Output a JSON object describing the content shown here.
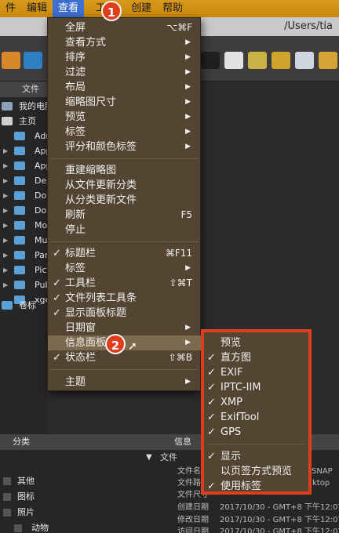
{
  "menubar": {
    "items": [
      {
        "label": "件"
      },
      {
        "label": "编辑"
      },
      {
        "label": "查看"
      },
      {
        "label": "工"
      },
      {
        "label": "创建"
      },
      {
        "label": "帮助"
      }
    ]
  },
  "window": {
    "path": "/Users/tia"
  },
  "folders": {
    "header": "文件夹",
    "items": [
      {
        "label": "我的电脑"
      },
      {
        "label": "主页"
      },
      {
        "label": "Adm"
      },
      {
        "label": "App"
      },
      {
        "label": "App"
      },
      {
        "label": "Des"
      },
      {
        "label": "Doc"
      },
      {
        "label": "Dow"
      },
      {
        "label": "Mov"
      },
      {
        "label": "Mus"
      },
      {
        "label": "Par"
      },
      {
        "label": "Pict"
      },
      {
        "label": "Pub"
      },
      {
        "label": "xge"
      },
      {
        "label": "卷标"
      }
    ]
  },
  "category": {
    "header": "分类",
    "items": [
      {
        "label": "其他"
      },
      {
        "label": "图标"
      },
      {
        "label": "照片"
      },
      {
        "label": "动物"
      }
    ]
  },
  "info": {
    "header": "信息",
    "section": "文件",
    "rows": [
      {
        "key": "文件名",
        "value": "_SNAP"
      },
      {
        "key": "文件路",
        "value": "ktop"
      },
      {
        "key": "文件尺寸",
        "value": ""
      },
      {
        "key": "创建日期",
        "value": "2017/10/30 - GMT+8 下午12:07:"
      },
      {
        "key": "修改日期",
        "value": "2017/10/30 - GMT+8 下午12:07:"
      },
      {
        "key": "访问日期",
        "value": "2017/10/30 - GMT+8 下午12:07:"
      }
    ]
  },
  "view_menu": {
    "items": [
      {
        "label": "全屏",
        "shortcut": "⌥⌘F",
        "check": "",
        "submenu": ""
      },
      {
        "label": "查看方式",
        "shortcut": "",
        "check": "",
        "submenu": "▶"
      },
      {
        "label": "排序",
        "shortcut": "",
        "check": "",
        "submenu": "▶"
      },
      {
        "label": "过滤",
        "shortcut": "",
        "check": "",
        "submenu": "▶"
      },
      {
        "label": "布局",
        "shortcut": "",
        "check": "",
        "submenu": "▶"
      },
      {
        "label": "缩略图尺寸",
        "shortcut": "",
        "check": "",
        "submenu": "▶"
      },
      {
        "label": "预览",
        "shortcut": "",
        "check": "",
        "submenu": "▶"
      },
      {
        "label": "标签",
        "shortcut": "",
        "check": "",
        "submenu": "▶"
      },
      {
        "label": "评分和颜色标签",
        "shortcut": "",
        "check": "",
        "submenu": "▶"
      },
      {
        "label": "重建缩略图",
        "shortcut": "",
        "check": "",
        "submenu": ""
      },
      {
        "label": "从文件更新分类",
        "shortcut": "",
        "check": "",
        "submenu": ""
      },
      {
        "label": "从分类更新文件",
        "shortcut": "",
        "check": "",
        "submenu": ""
      },
      {
        "label": "刷新",
        "shortcut": "F5",
        "check": "",
        "submenu": ""
      },
      {
        "label": "停止",
        "shortcut": "",
        "check": "",
        "submenu": ""
      },
      {
        "label": "标题栏",
        "shortcut": "⌘F11",
        "check": "✓",
        "submenu": ""
      },
      {
        "label": "标签",
        "shortcut": "",
        "check": "",
        "submenu": "▶"
      },
      {
        "label": "工具栏",
        "shortcut": "⇧⌘T",
        "check": "✓",
        "submenu": ""
      },
      {
        "label": "文件列表工具条",
        "shortcut": "",
        "check": "✓",
        "submenu": ""
      },
      {
        "label": "显示面板标题",
        "shortcut": "",
        "check": "✓",
        "submenu": ""
      },
      {
        "label": "日期窗",
        "shortcut": "",
        "check": "",
        "submenu": "▶"
      },
      {
        "label": "信息面板",
        "shortcut": "",
        "check": "",
        "submenu": "▶"
      },
      {
        "label": "状态栏",
        "shortcut": "⇧⌘B",
        "check": "✓",
        "submenu": ""
      },
      {
        "label": "主题",
        "shortcut": "",
        "check": "",
        "submenu": "▶"
      }
    ]
  },
  "info_submenu": {
    "items": [
      {
        "label": "预览",
        "check": ""
      },
      {
        "label": "直方图",
        "check": "✓"
      },
      {
        "label": "EXIF",
        "check": "✓"
      },
      {
        "label": "IPTC-IIM",
        "check": "✓"
      },
      {
        "label": "XMP",
        "check": "✓"
      },
      {
        "label": "ExifTool",
        "check": "✓"
      },
      {
        "label": "GPS",
        "check": "✓"
      },
      {
        "label": "显示",
        "check": "✓"
      },
      {
        "label": "以页签方式预览",
        "check": ""
      },
      {
        "label": "使用标签",
        "check": "✓"
      }
    ]
  },
  "annotations": {
    "step1": "1",
    "step2": "2"
  },
  "colors": {
    "menubar": "#d89a1a",
    "menu_bg": "#534531",
    "highlight_box": "#e03d1c",
    "badge": "#e03d1c"
  }
}
